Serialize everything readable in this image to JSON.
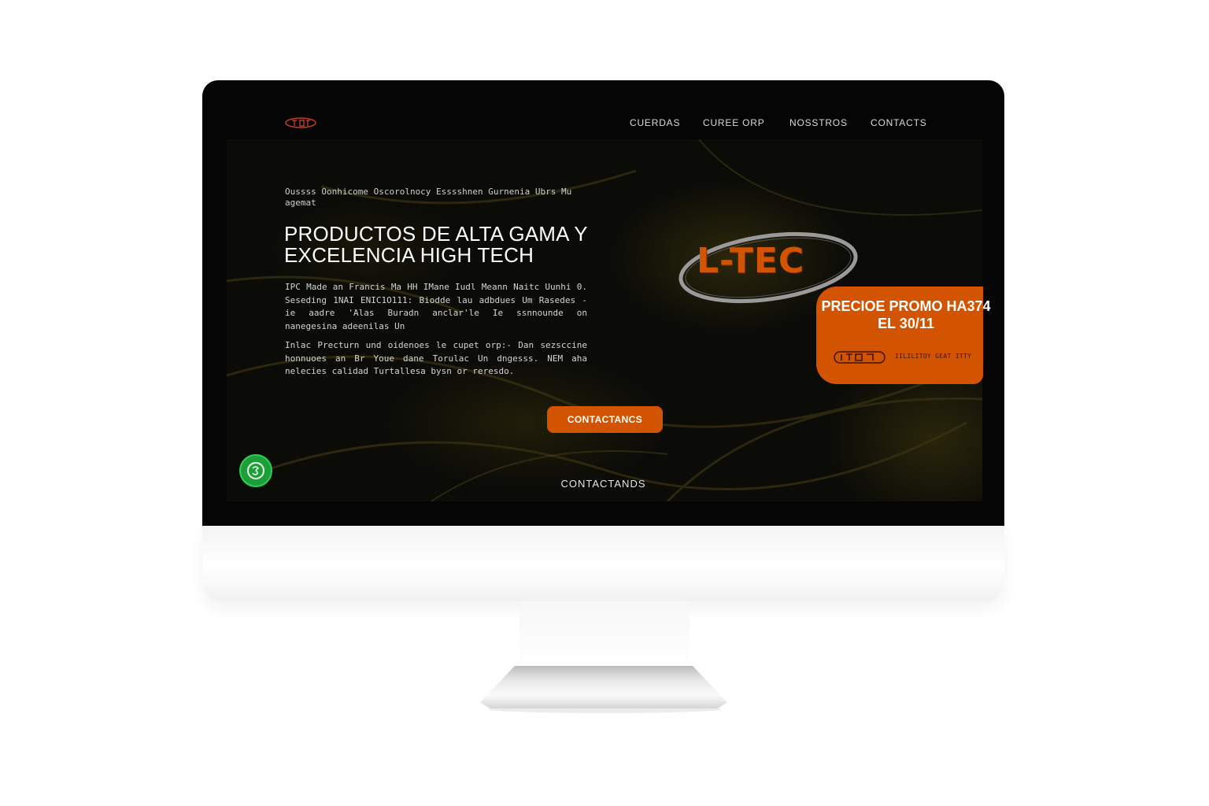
{
  "nav": {
    "items": [
      {
        "label": "CUERDAS"
      },
      {
        "label": "CUREE ORP"
      },
      {
        "label": "NOSSTROS"
      },
      {
        "label": "CONTACTS"
      }
    ]
  },
  "hero": {
    "eyebrow": "Oussss Oonhicome Oscorolnocy Esssshnen Gurnenia Ubrs Mu agemat",
    "headline": "PRODUCTOS DE ALTA GAMA Y EXCELENCIA HIGH TECH",
    "body_1": "IPC Made an Francis Ma HH IMane Iudl Meann Naitc Uunhi 0. Seseding  1NAI ENIC1O111: Biodde lau adbdues Um Rasedes -ie aadre 'Alas Buradn anclar'le Ie ssnnounde on nanegesina adeenilas Un",
    "body_2": "Inlac Precturn und oidenoes le cupet orp:- Dan sezsccine honnuoes an Br Youe dane Torulac Un dngesss. NEM aha nelecies calidad Turtallesa bysn or reresdo.",
    "cta_label": "CONTACTANCS",
    "secondary_label": "CONTACTANDS"
  },
  "brand": {
    "logo_text": "L-TEC",
    "accent_color": "#d35400",
    "ellipse_color": "#9a9a9a"
  },
  "promo": {
    "title": "PRECIOE PROMO HA374 EL 30/11",
    "tag": "IILILITOY GEAT ITTY"
  },
  "icons": {
    "whatsapp": "whatsapp-icon",
    "logo": "brand-logo-icon"
  }
}
